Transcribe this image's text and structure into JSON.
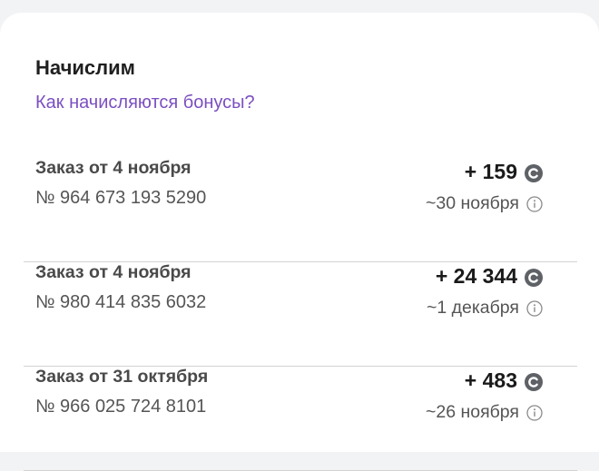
{
  "section": {
    "title": "Начислим",
    "help_link": "Как начисляются бонусы?"
  },
  "orders": [
    {
      "title": "Заказ от 4 ноября",
      "number": "№ 964 673 193 5290",
      "amount": "+ 159",
      "date": "~30 ноября"
    },
    {
      "title": "Заказ от 4 ноября",
      "number": "№ 980 414 835 6032",
      "amount": "+ 24 344",
      "date": "~1 декабря"
    },
    {
      "title": "Заказ от 31 октября",
      "number": "№ 966 025 724 8101",
      "amount": "+ 483",
      "date": "~26 ноября"
    }
  ],
  "icons": {
    "bonus": "bonus-coin-icon",
    "info": "info-icon"
  },
  "colors": {
    "link": "#7b4fc1",
    "bonus_icon": "#5e6166",
    "divider": "#d3d3d3"
  }
}
